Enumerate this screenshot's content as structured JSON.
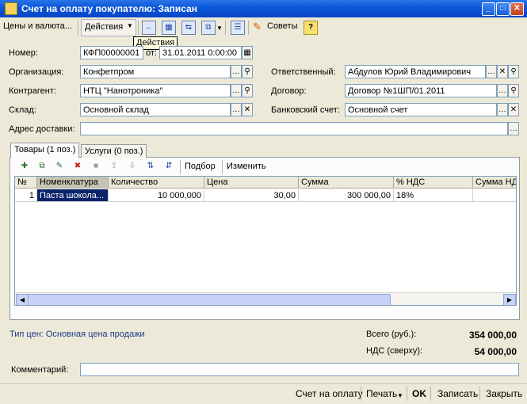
{
  "window": {
    "title": "Счет на оплату покупателю: Записан",
    "minimize": "_",
    "maximize": "□",
    "close": "✕"
  },
  "toolbar": {
    "prices_label": "Цены и валюта...",
    "actions_label": "Действия",
    "tooltip": "Действия",
    "advice_label": "Советы",
    "help_glyph": "?"
  },
  "form": {
    "number_label": "Номер:",
    "number_value": "КФП00000001",
    "date_label": "от:",
    "date_value": "31.01.2011 0:00:00",
    "org_label": "Организация:",
    "org_value": "Конфетпром",
    "responsible_label": "Ответственный:",
    "responsible_value": "Абдулов Юрий Владимирович",
    "contractor_label": "Контрагент:",
    "contractor_value": "НТЦ \"Нанотроника\"",
    "contract_label": "Договор:",
    "contract_value": "Договор №1ШП/01.2011",
    "warehouse_label": "Склад:",
    "warehouse_value": "Основной склад",
    "bank_label": "Банковский счет:",
    "bank_value": "Основной счет",
    "address_label": "Адрес доставки:",
    "address_value": ""
  },
  "tabs": [
    {
      "label": "Товары (1 поз.)"
    },
    {
      "label": "Услуги (0 поз.)"
    }
  ],
  "grid_toolbar": {
    "select_label": "Подбор",
    "change_label": "Изменить"
  },
  "grid": {
    "columns": [
      "№",
      "Номенклатура",
      "Количество",
      "Цена",
      "Сумма",
      "% НДС",
      "Сумма НДС"
    ],
    "rows": [
      {
        "n": "1",
        "item": "Паста шокола...",
        "qty": "10 000,000",
        "price": "30,00",
        "sum": "300 000,00",
        "vat_pct": "18%",
        "vat_sum": ""
      }
    ]
  },
  "summary": {
    "price_type": "Тип цен: Основная цена продажи",
    "total_label": "Всего (руб.):",
    "total_value": "354 000,00",
    "vat_label": "НДС (сверху):",
    "vat_value": "54 000,00"
  },
  "comment": {
    "label": "Комментарий:",
    "value": ""
  },
  "bottom": {
    "invoice": "Счет на оплату",
    "print": "Печать",
    "ok": "OK",
    "save": "Записать",
    "close": "Закрыть"
  }
}
